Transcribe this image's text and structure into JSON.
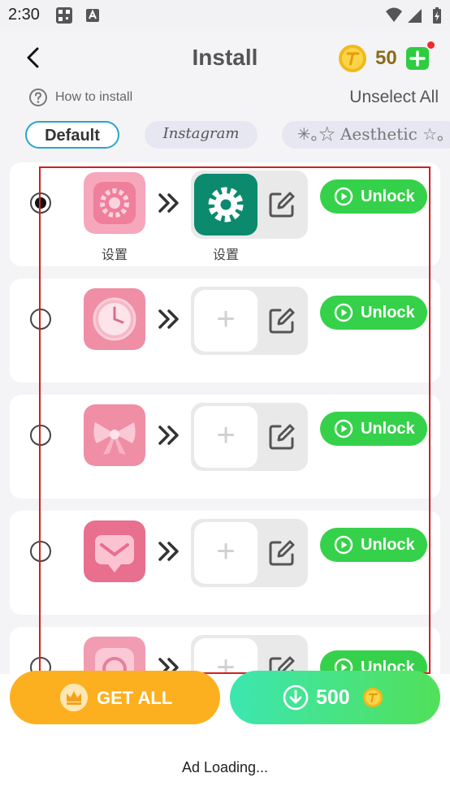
{
  "status_bar": {
    "time": "2:30"
  },
  "header": {
    "title": "Install",
    "coins": "50"
  },
  "toolbar": {
    "how_to_install": "How to install",
    "unselect_all": "Unselect All"
  },
  "tabs": [
    {
      "label": "Default",
      "selected": true
    },
    {
      "label": "Instagram",
      "selected": false
    },
    {
      "label": "✳︎｡☆ Aesthetic ☆｡",
      "selected": false
    }
  ],
  "rows": [
    {
      "selected": true,
      "source_icon": "settings-gear-pink-icon",
      "source_label": "设置",
      "target_icon": "settings-gear-icon",
      "target_label": "设置",
      "unlock_label": "Unlock"
    },
    {
      "selected": false,
      "source_icon": "clock-pink-icon",
      "source_label": "",
      "target_icon": "add-icon",
      "target_label": "",
      "unlock_label": "Unlock"
    },
    {
      "selected": false,
      "source_icon": "bow-pink-icon",
      "source_label": "",
      "target_icon": "add-icon",
      "target_label": "",
      "unlock_label": "Unlock"
    },
    {
      "selected": false,
      "source_icon": "message-pink-icon",
      "source_label": "",
      "target_icon": "add-icon",
      "target_label": "",
      "unlock_label": "Unlock"
    },
    {
      "selected": false,
      "source_icon": "camera-pink-icon",
      "source_label": "",
      "target_icon": "add-icon",
      "target_label": "",
      "unlock_label": "Unlock"
    }
  ],
  "actions": {
    "get_all": "GET ALL",
    "buy_price": "500"
  },
  "footer": {
    "ad_text": "Ad Loading..."
  },
  "colors": {
    "accent_green": "#35d14a",
    "accent_orange": "#fdb01f",
    "tab_border": "#2aa6c6",
    "selection_frame": "#d21f1f"
  }
}
